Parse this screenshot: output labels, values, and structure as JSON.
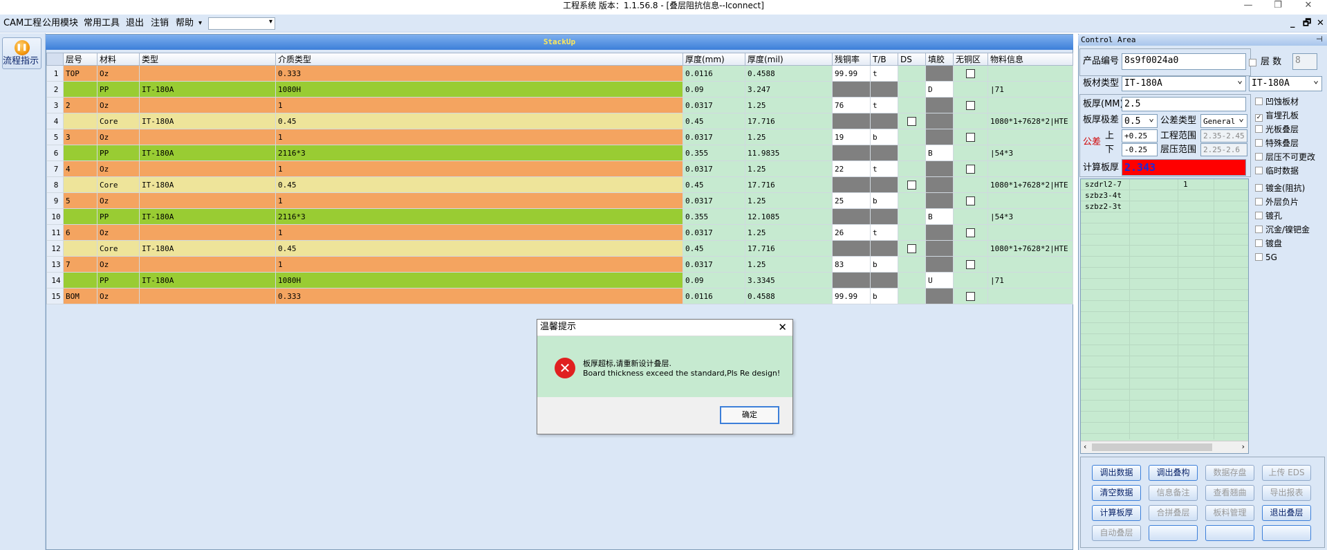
{
  "title": "工程系统  版本：1.1.56.8 - [叠层阻抗信息--Iconnect]",
  "window_controls": [
    "—",
    "❐",
    "✕"
  ],
  "menu": [
    "CAM工程",
    "公用模块",
    "常用工具",
    "退出",
    "注销",
    "帮助"
  ],
  "mdi_controls": [
    "_",
    "🗗",
    "✕"
  ],
  "left": {
    "flow_label": "流程指示"
  },
  "stack": {
    "header": "StackUp",
    "columns": [
      "层号",
      "材料",
      "类型",
      "介质类型",
      "厚度(mm)",
      "厚度(mil)",
      "残铜率",
      "T/B",
      "DS",
      "填胶",
      "无铜区",
      "物料信息"
    ],
    "rows": [
      {
        "n": "1",
        "layer": "TOP",
        "mat": "Oz",
        "type": "",
        "diel": "0.333",
        "mm": "0.0116",
        "mil": "0.4588",
        "res": "99.99",
        "tb": "t",
        "fill": "",
        "fc": "dg",
        "ds": false,
        "nc": true,
        "info": ""
      },
      {
        "n": "2",
        "layer": "",
        "mat": "PP",
        "type": "IT-180A",
        "diel": "1080H",
        "mm": "0.09",
        "mil": "3.247",
        "res": "",
        "tb": "",
        "fill": "D",
        "fc": "w",
        "ds": false,
        "nc": false,
        "info": "|71"
      },
      {
        "n": "3",
        "layer": "2",
        "mat": "Oz",
        "type": "",
        "diel": "1",
        "mm": "0.0317",
        "mil": "1.25",
        "res": "76",
        "tb": "t",
        "fill": "",
        "fc": "dg",
        "ds": false,
        "nc": true,
        "info": ""
      },
      {
        "n": "4",
        "layer": "",
        "mat": "Core",
        "type": "IT-180A",
        "diel": "0.45",
        "mm": "0.45",
        "mil": "17.716",
        "res": "",
        "tb": "",
        "fill": "",
        "fc": "dg",
        "ds": true,
        "nc": false,
        "info": "1080*1+7628*2|HTE"
      },
      {
        "n": "5",
        "layer": "3",
        "mat": "Oz",
        "type": "",
        "diel": "1",
        "mm": "0.0317",
        "mil": "1.25",
        "res": "19",
        "tb": "b",
        "fill": "",
        "fc": "dg",
        "ds": false,
        "nc": true,
        "info": ""
      },
      {
        "n": "6",
        "layer": "",
        "mat": "PP",
        "type": "IT-180A",
        "diel": "2116*3",
        "mm": "0.355",
        "mil": "11.9835",
        "res": "",
        "tb": "",
        "fill": "B",
        "fc": "w",
        "ds": false,
        "nc": false,
        "info": "|54*3"
      },
      {
        "n": "7",
        "layer": "4",
        "mat": "Oz",
        "type": "",
        "diel": "1",
        "mm": "0.0317",
        "mil": "1.25",
        "res": "22",
        "tb": "t",
        "fill": "",
        "fc": "dg",
        "ds": false,
        "nc": true,
        "info": ""
      },
      {
        "n": "8",
        "layer": "",
        "mat": "Core",
        "type": "IT-180A",
        "diel": "0.45",
        "mm": "0.45",
        "mil": "17.716",
        "res": "",
        "tb": "",
        "fill": "",
        "fc": "dg",
        "ds": true,
        "nc": false,
        "info": "1080*1+7628*2|HTE"
      },
      {
        "n": "9",
        "layer": "5",
        "mat": "Oz",
        "type": "",
        "diel": "1",
        "mm": "0.0317",
        "mil": "1.25",
        "res": "25",
        "tb": "b",
        "fill": "",
        "fc": "dg",
        "ds": false,
        "nc": true,
        "info": ""
      },
      {
        "n": "10",
        "layer": "",
        "mat": "PP",
        "type": "IT-180A",
        "diel": "2116*3",
        "mm": "0.355",
        "mil": "12.1085",
        "res": "",
        "tb": "",
        "fill": "B",
        "fc": "w",
        "ds": false,
        "nc": false,
        "info": "|54*3"
      },
      {
        "n": "11",
        "layer": "6",
        "mat": "Oz",
        "type": "",
        "diel": "1",
        "mm": "0.0317",
        "mil": "1.25",
        "res": "26",
        "tb": "t",
        "fill": "",
        "fc": "dg",
        "ds": false,
        "nc": true,
        "info": ""
      },
      {
        "n": "12",
        "layer": "",
        "mat": "Core",
        "type": "IT-180A",
        "diel": "0.45",
        "mm": "0.45",
        "mil": "17.716",
        "res": "",
        "tb": "",
        "fill": "",
        "fc": "dg",
        "ds": true,
        "nc": false,
        "info": "1080*1+7628*2|HTE"
      },
      {
        "n": "13",
        "layer": "7",
        "mat": "Oz",
        "type": "",
        "diel": "1",
        "mm": "0.0317",
        "mil": "1.25",
        "res": "83",
        "tb": "b",
        "fill": "",
        "fc": "dg",
        "ds": false,
        "nc": true,
        "info": ""
      },
      {
        "n": "14",
        "layer": "",
        "mat": "PP",
        "type": "IT-180A",
        "diel": "1080H",
        "mm": "0.09",
        "mil": "3.3345",
        "res": "",
        "tb": "",
        "fill": "U",
        "fc": "w",
        "ds": false,
        "nc": false,
        "info": "|71"
      },
      {
        "n": "15",
        "layer": "BOM",
        "mat": "Oz",
        "type": "",
        "diel": "0.333",
        "mm": "0.0116",
        "mil": "0.4588",
        "res": "99.99",
        "tb": "b",
        "fill": "",
        "fc": "dg",
        "ds": false,
        "nc": true,
        "info": ""
      }
    ]
  },
  "dialog": {
    "title": "温馨提示",
    "msg_cn": "板厚超标,请重新设计叠层.",
    "msg_en": "Board thickness exceed the standard,Pls Re design!",
    "ok": "确定"
  },
  "control": {
    "header": "Control Area",
    "product_label": "产品编号",
    "product_value": "8s9f0024a0",
    "layers_label": "层 数",
    "layers_value": "8",
    "board_type_label": "板材类型",
    "board_type_value": "IT-180A",
    "board_type_value2": "IT-180A",
    "thickness_label": "板厚(MM)",
    "thickness_value": "2.5",
    "tol_label": "板厚极差",
    "tol_value": "0.5",
    "tol_type_label": "公差类型",
    "tol_type_value": "General",
    "tol_main": "公差",
    "up_label": "上",
    "down_label": "下",
    "up_value": "+0.25",
    "down_value": "-0.25",
    "eng_range_label": "工程范围",
    "eng_range_value": "2.35-2.45",
    "press_range_label": "层压范围",
    "press_range_value": "2.25-2.6",
    "calc_label": "计算板厚",
    "calc_value": "2.343",
    "options": [
      {
        "label": "凹蚀板材",
        "on": false
      },
      {
        "label": "盲埋孔板",
        "on": true
      },
      {
        "label": "光板叠层",
        "on": false
      },
      {
        "label": "特殊叠层",
        "on": false
      },
      {
        "label": "层压不可更改",
        "on": false
      },
      {
        "label": "临时数据",
        "on": false
      },
      {
        "label": "镀金(阻抗)",
        "on": false
      },
      {
        "label": "外层负片",
        "on": false
      },
      {
        "label": "镀孔",
        "on": false
      },
      {
        "label": "沉金/镍钯金",
        "on": false
      },
      {
        "label": "镀盘",
        "on": false
      },
      {
        "label": "5G",
        "on": false
      }
    ],
    "list": [
      {
        "name": "szdrl2-7",
        "value": "1"
      },
      {
        "name": "szbz3-4t",
        "value": ""
      },
      {
        "name": "szbz2-3t",
        "value": ""
      }
    ],
    "buttons": [
      {
        "label": "调出数据",
        "state": "act"
      },
      {
        "label": "调出叠构",
        "state": "act"
      },
      {
        "label": "数据存盘",
        "state": "off"
      },
      {
        "label": "上传 EDS",
        "state": "off"
      },
      {
        "label": "清空数据",
        "state": "act"
      },
      {
        "label": "信息备注",
        "state": "off"
      },
      {
        "label": "查看翘曲",
        "state": "off"
      },
      {
        "label": "导出报表",
        "state": "off"
      },
      {
        "label": "计算板厚",
        "state": "act"
      },
      {
        "label": "合拼叠层",
        "state": "off"
      },
      {
        "label": "板料管理",
        "state": "off"
      },
      {
        "label": "退出叠层",
        "state": "act"
      },
      {
        "label": "自动叠层",
        "state": "off"
      },
      {
        "label": "",
        "state": "act"
      },
      {
        "label": "",
        "state": "act"
      },
      {
        "label": "",
        "state": "act"
      }
    ]
  }
}
